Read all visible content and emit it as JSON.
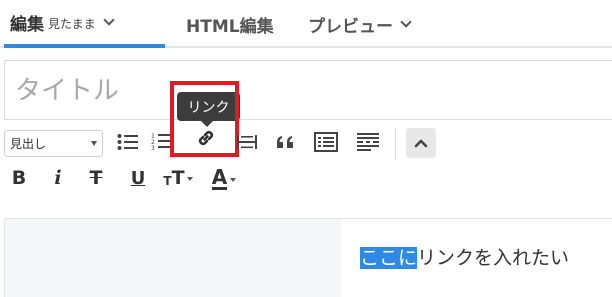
{
  "tabs": {
    "edit_label": "編集",
    "edit_mode": "見たまま",
    "html_label": "HTML編集",
    "preview_label": "プレビュー"
  },
  "title_placeholder": "タイトル",
  "toolbar": {
    "format_select": "見出し",
    "tooltip": "リンク",
    "icons": [
      "unordered-list-icon",
      "ordered-list-icon",
      "link-icon",
      "horizontal-rule-icon",
      "blockquote-icon",
      "table-of-contents-icon",
      "more-icon",
      "collapse-icon"
    ],
    "format_buttons": {
      "bold": "B",
      "italic": "i",
      "strike": "T",
      "underline": "U",
      "font_size": "T",
      "font_color": "A"
    }
  },
  "editor": {
    "selected_text": "ここに",
    "rest_text": "リンクを入れたい"
  },
  "colors": {
    "accent": "#2f8bd8",
    "highlight": "#e01b24",
    "selection": "#2f8ae5"
  }
}
